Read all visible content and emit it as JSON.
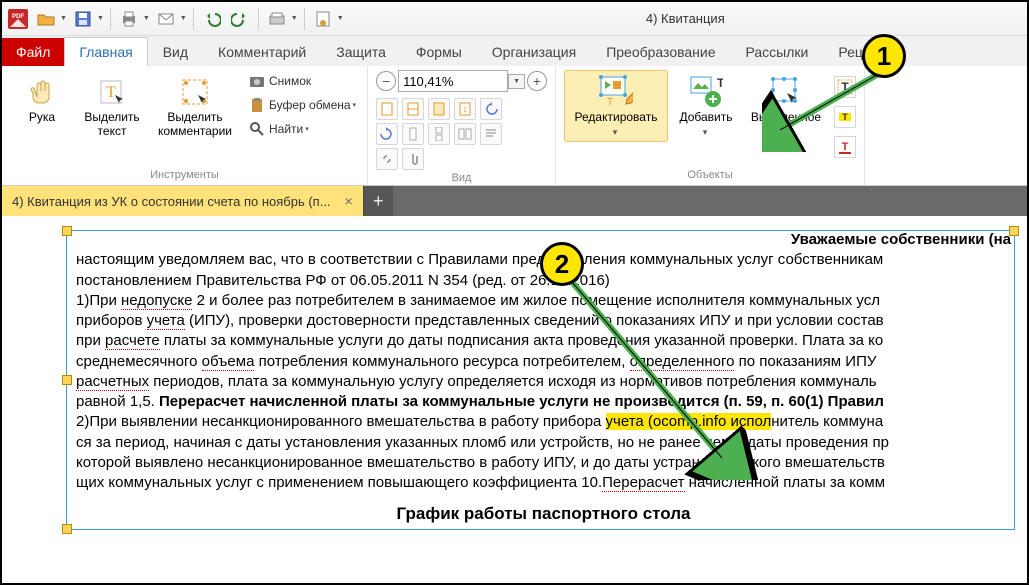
{
  "qat": {
    "title": "4) Квитанция"
  },
  "tabs": {
    "file": "Файл",
    "items": [
      "Главная",
      "Вид",
      "Комментарий",
      "Защита",
      "Формы",
      "Организация",
      "Преобразование",
      "Рассылки",
      "Реце"
    ],
    "activeIndex": 0
  },
  "ribbon": {
    "tools": {
      "hand": "Рука",
      "select_text": "Выделить\nтекст",
      "select_comments": "Выделить\nкомментарии",
      "label": "Инструменты"
    },
    "clip": {
      "snapshot": "Снимок",
      "clipboard": "Буфер обмена",
      "find": "Найти"
    },
    "view": {
      "zoom_value": "110,41%",
      "label": "Вид"
    },
    "objects": {
      "edit": "Редактировать",
      "add": "Добавить",
      "selected": "Выделенное",
      "label": "Объекты"
    }
  },
  "doctab": {
    "title": "4) Квитанция из УК о состоянии счета по ноябрь (п..."
  },
  "doc": {
    "heading": "Уважаемые собственники (на",
    "l1a": "настоящим уведомляем вас, что в соответствии с Правилами предоставления коммунальных услуг собственникам",
    "l1b": "постановлением Правительства РФ от 06.05.2011 N 354 (ред. от 26.12.2016)",
    "l2": "1)При недопуске 2 и более раз потребителем в занимаемое им жилое помещение исполнителя коммунальных усл",
    "l3": "приборов учета (ИПУ), проверки достоверности представленных сведений о показаниях ИПУ и при условии состав",
    "l4": "при расчете платы за коммунальные услуги до даты подписания акта проведения указанной проверки. Плата за ко",
    "l5": "среднемесячного объема потребления коммунального ресурса потребителем, определенного по показаниям ИПУ",
    "l6": "расчетных периодов, плата за коммунальную услугу определяется исходя из нормативов потребления коммуналь",
    "l7a": "равной 1,5. ",
    "l7b": "Перерасчет начисленной платы за коммунальные услуги не производится (п. 59, п. 60(1) Правил",
    "l8a": "2)При выявлении несанкционированного вмешательства в работу прибора ",
    "l8hl": "учета (ocomp.info испол",
    "l8b": "нитель коммуна",
    "l9": "ся за период, начиная с даты установления указанных пломб или устройств, но не ранее чем с даты проведения пр",
    "l10": "которой выявлено несанкционированное вмешательство в работу ИПУ, и до даты устранения такого вмешательств",
    "l11": "щих коммунальных услуг с применением повышающего коэффициента 10.Перерасчет начисленной платы за комм",
    "h2": "График работы паспортного стола"
  },
  "bubbles": {
    "b1": "1",
    "b2": "2"
  }
}
